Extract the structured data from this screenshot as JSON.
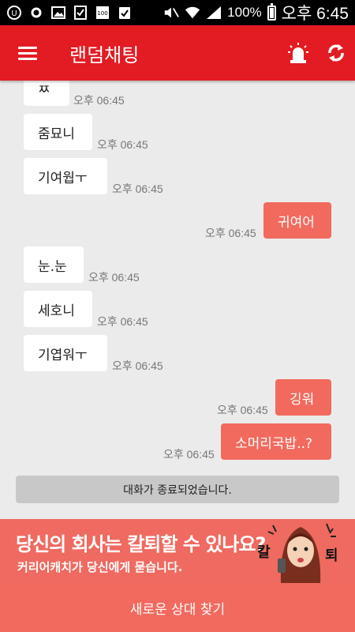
{
  "status_bar": {
    "battery_percent": "100%",
    "time": "오후 6:45",
    "icons": [
      "u-plus-icon",
      "ring-icon",
      "image-icon",
      "checklist-icon",
      "battery-100-icon",
      "clipboard-check-icon",
      "mute-icon",
      "wifi-icon",
      "signal-icon",
      "battery-icon"
    ]
  },
  "app_bar": {
    "title": "랜덤채팅",
    "icons": [
      "menu-icon",
      "siren-icon",
      "refresh-icon"
    ],
    "color": "#e31b23"
  },
  "messages": [
    {
      "side": "in",
      "text": "ㅉ",
      "time": "오후 06:45"
    },
    {
      "side": "in",
      "text": "줌묘니",
      "time": "오후 06:45"
    },
    {
      "side": "in",
      "text": "기여웝ㅜ",
      "time": "오후 06:45"
    },
    {
      "side": "out",
      "text": "귀여어",
      "time": "오후 06:45"
    },
    {
      "side": "in",
      "text": "눈.눈",
      "time": "오후 06:45"
    },
    {
      "side": "in",
      "text": "세호니",
      "time": "오후 06:45"
    },
    {
      "side": "in",
      "text": "기엽워ㅜ",
      "time": "오후 06:45"
    },
    {
      "side": "out",
      "text": "깅워",
      "time": "오후 06:45"
    },
    {
      "side": "out",
      "text": "소머리국밥..?",
      "time": "오후 06:45"
    }
  ],
  "ended_notice": "대화가 종료되었습니다.",
  "ad": {
    "headline": "당신의 회사는 칼퇴할 수 있나요?",
    "subline": "커리어캐치가 당신에게 묻습니다.",
    "art_text_left": "칼",
    "art_text_right": "퇴"
  },
  "find_button": "새로운 상대 찾기",
  "colors": {
    "accent": "#e31b23",
    "outgoing_bubble": "#f26a5e",
    "incoming_bubble": "#ffffff",
    "background": "#ebebeb"
  }
}
